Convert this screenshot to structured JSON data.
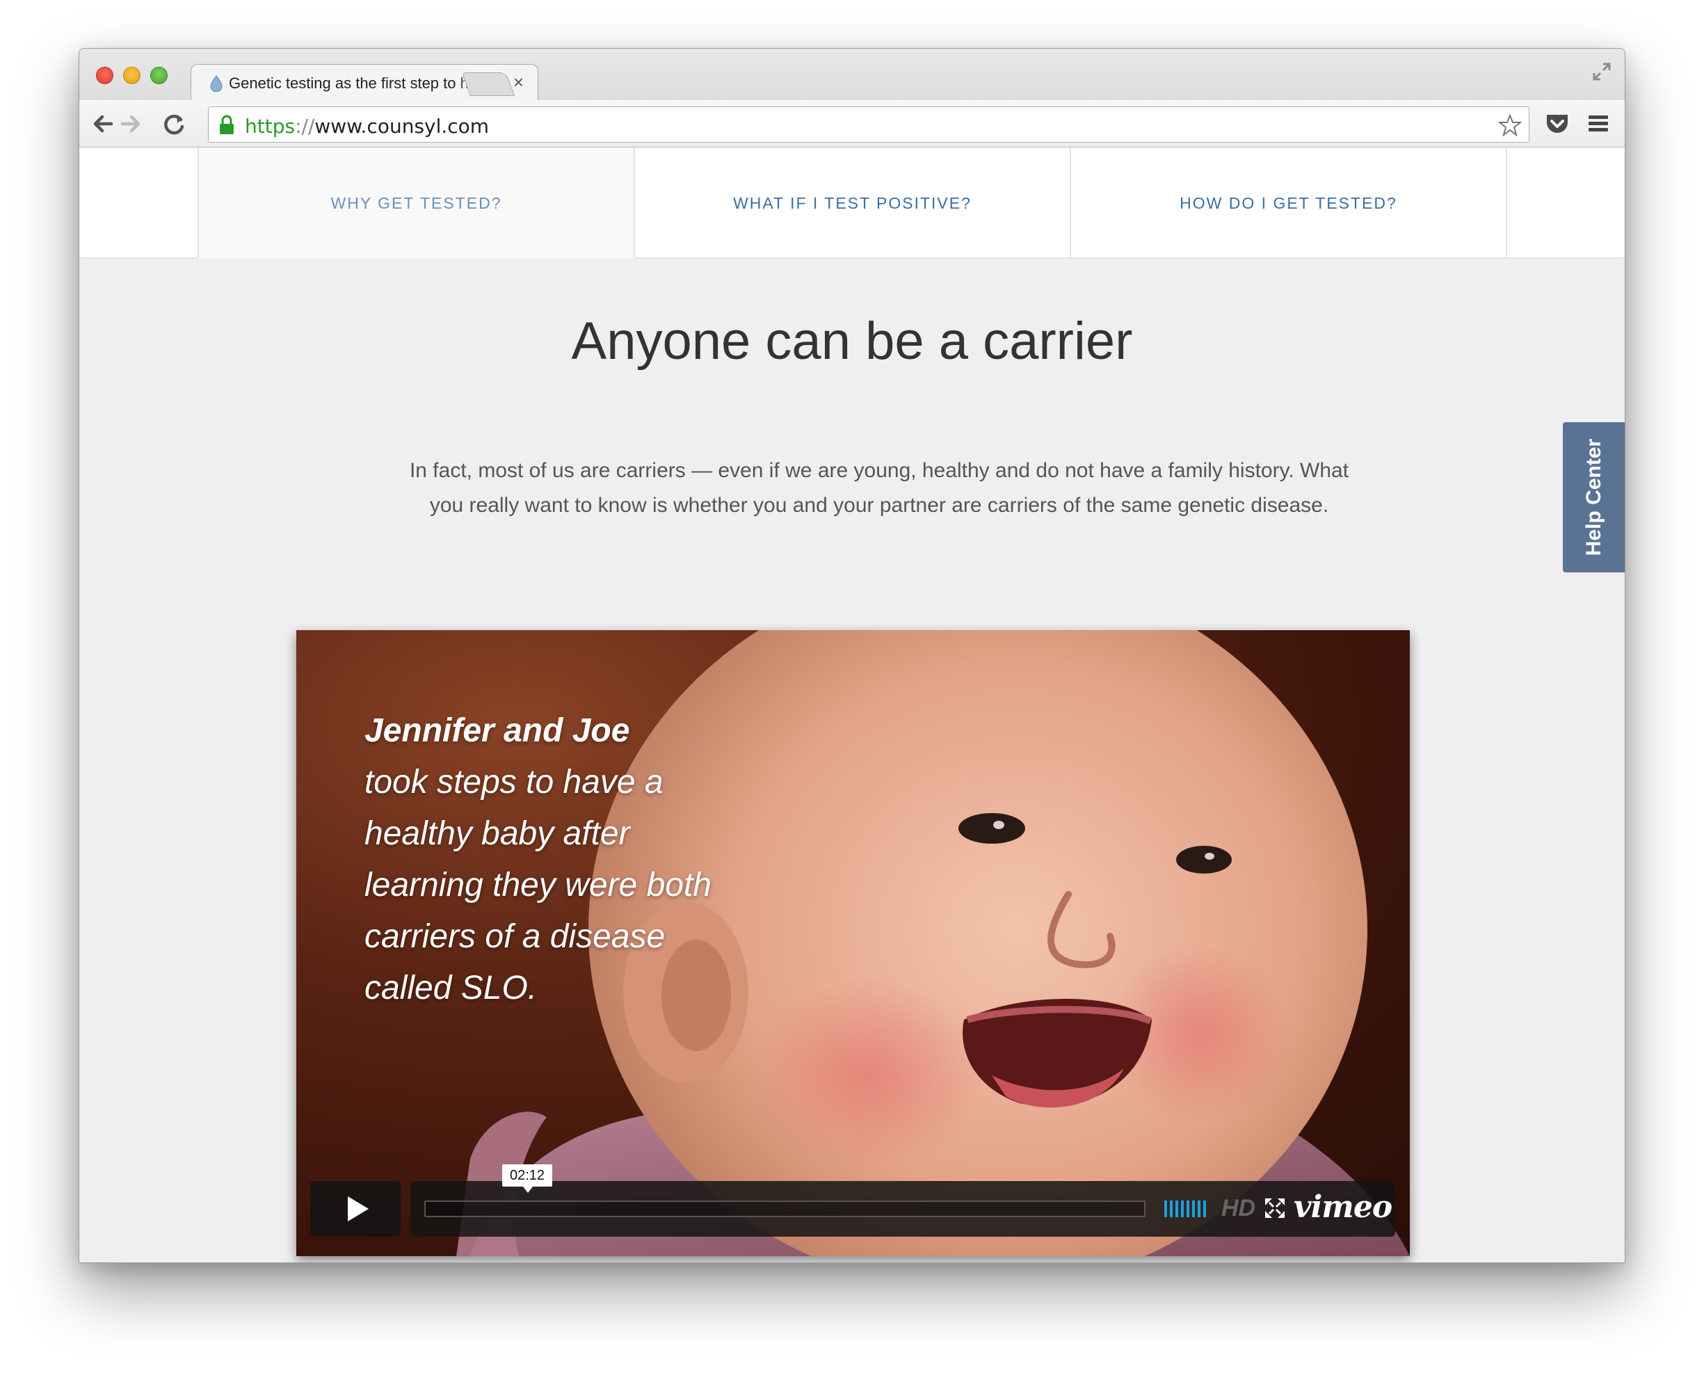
{
  "browser": {
    "tab_title": "Genetic testing as the first step to having a healthy baby",
    "tab_close": "×",
    "url_scheme": "https",
    "url_separator": "://",
    "url_host": "www.counsyl.com"
  },
  "nav": {
    "items": [
      {
        "label": "WHY GET TESTED?",
        "active": true
      },
      {
        "label": "WHAT IF I TEST POSITIVE?",
        "active": false
      },
      {
        "label": "HOW DO I GET TESTED?",
        "active": false
      }
    ]
  },
  "main": {
    "headline": "Anyone can be a carrier",
    "body": "In fact, most of us are carriers — even if we are young, healthy and do not have a family history. What you really want to know is whether you and your partner are carriers of the same genetic disease."
  },
  "help_center": {
    "label": "Help Center"
  },
  "video": {
    "caption_names": "Jennifer and Joe",
    "caption_rest": "took steps to have a healthy baby after learning they were both carriers of a disease called SLO.",
    "duration": "02:12",
    "hd_label": "HD",
    "brand": "vimeo",
    "play_icon": "play-icon",
    "volume_icon": "volume-icon",
    "fullscreen_icon": "fullscreen-icon"
  },
  "colors": {
    "nav_link": "#3a6ea5",
    "help_tab": "#5a7394",
    "volume_accent": "#1aa1e0"
  }
}
